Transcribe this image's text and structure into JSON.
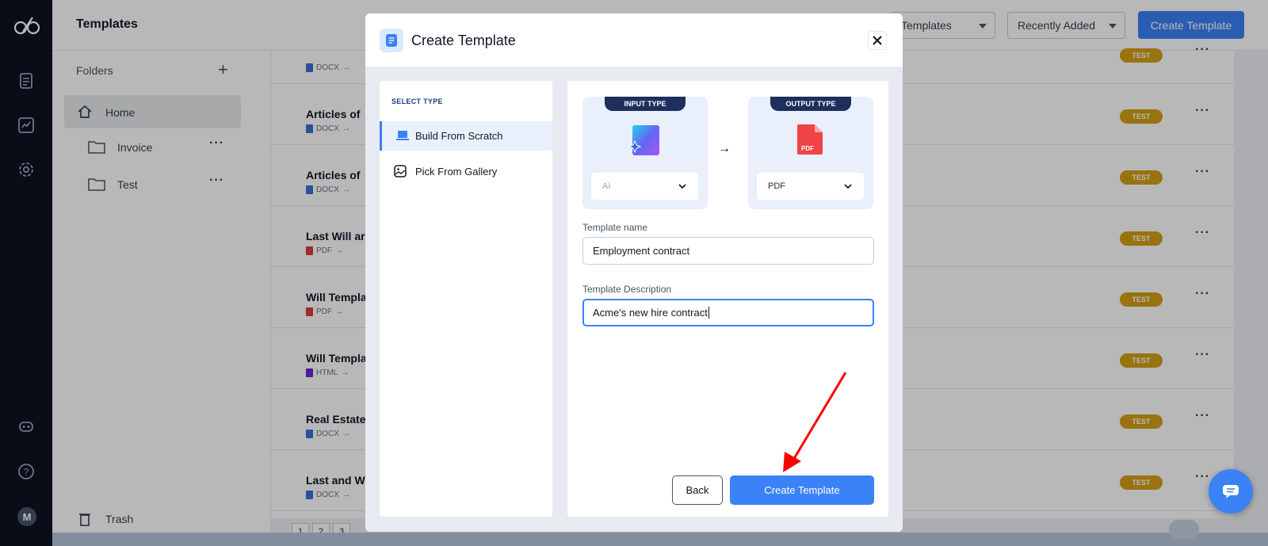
{
  "app": {
    "page_title": "Templates",
    "header": {
      "filter_label": "Templates",
      "sort_label": "Recently Added",
      "create_label": "Create Template"
    }
  },
  "sidebar": {
    "folders_title": "Folders",
    "items": [
      {
        "label": "Home"
      },
      {
        "label": "Invoice"
      },
      {
        "label": "Test"
      }
    ],
    "trash_label": "Trash",
    "avatar_initial": "M"
  },
  "list": {
    "rows": [
      {
        "title": "",
        "from": "DOCX",
        "badge": "TEST"
      },
      {
        "title": "Articles of",
        "from": "DOCX",
        "badge": "TEST"
      },
      {
        "title": "Articles of",
        "from": "DOCX",
        "badge": "TEST"
      },
      {
        "title": "Last Will ar",
        "from": "PDF",
        "badge": "TEST"
      },
      {
        "title": "Will Templa",
        "from": "PDF",
        "badge": "TEST"
      },
      {
        "title": "Will Templa",
        "from": "HTML",
        "badge": "TEST"
      },
      {
        "title": "Real Estate",
        "from": "DOCX",
        "badge": "TEST"
      },
      {
        "title": "Last and W",
        "from": "DOCX",
        "badge": "TEST"
      }
    ],
    "pages": [
      "1",
      "2",
      "3"
    ]
  },
  "modal": {
    "title": "Create Template",
    "select_type_heading": "SELECT TYPE",
    "types": [
      {
        "label": "Build From Scratch",
        "active": true
      },
      {
        "label": "Pick From Gallery",
        "active": false
      }
    ],
    "input_type": {
      "tag": "INPUT TYPE",
      "value": "AI"
    },
    "output_type": {
      "tag": "OUTPUT TYPE",
      "value": "PDF",
      "file_label": "PDF"
    },
    "template_name": {
      "label": "Template name",
      "value": "Employment contract"
    },
    "template_description": {
      "label": "Template Description",
      "value": "Acme's new hire contract"
    },
    "back_label": "Back",
    "create_label": "Create Template"
  },
  "colors": {
    "accent": "#3b82f6",
    "badge": "#d4a017",
    "rail": "#0c1222",
    "annotation_arrow": "#ff0000"
  }
}
